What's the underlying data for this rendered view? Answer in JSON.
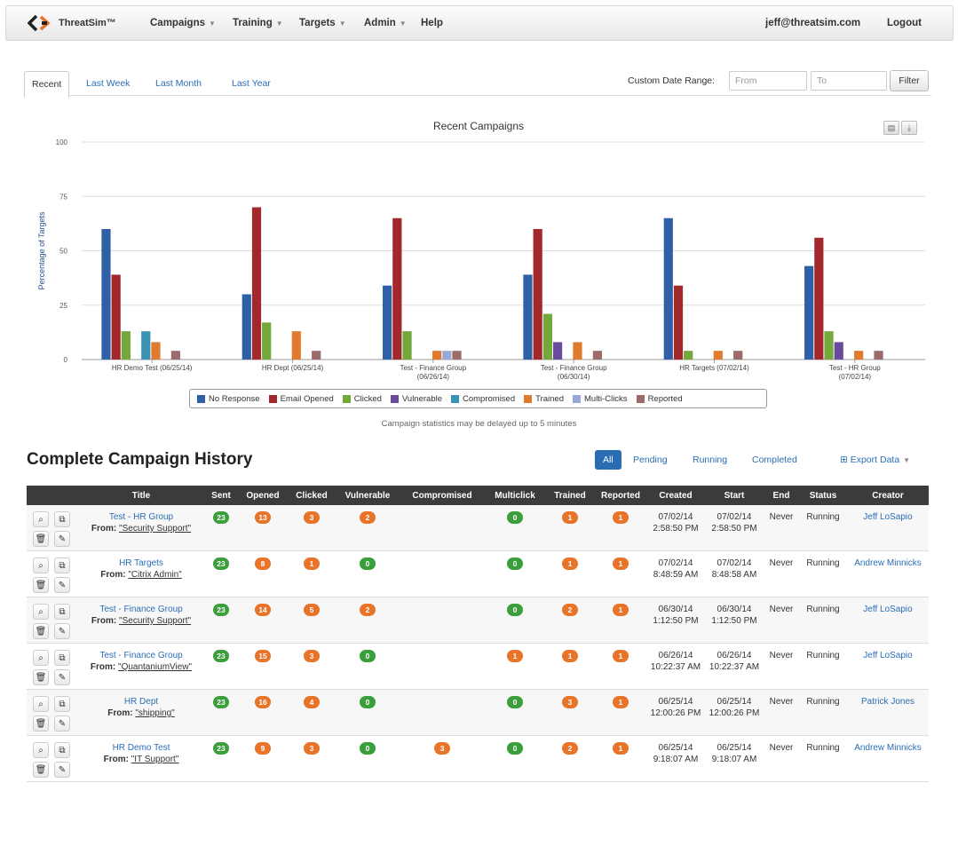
{
  "nav": {
    "brand": "ThreatSim™",
    "items": [
      "Campaigns",
      "Training",
      "Targets",
      "Admin",
      "Help"
    ],
    "user": "jeff@threatsim.com",
    "logout": "Logout"
  },
  "tabs": [
    "Recent",
    "Last Week",
    "Last Month",
    "Last Year"
  ],
  "date_range": {
    "label": "Custom Date Range:",
    "from_placeholder": "From",
    "to_placeholder": "To",
    "filter": "Filter"
  },
  "chart_data": {
    "type": "bar",
    "title": "Recent Campaigns",
    "ylabel": "Percentage of Targets",
    "ylim": [
      0,
      100
    ],
    "yticks": [
      0,
      25,
      50,
      75,
      100
    ],
    "grid": true,
    "legend_position": "bottom",
    "categories": [
      "HR Demo Test (06/25/14)",
      "HR Dept (06/25/14)",
      "Test - Finance Group (06/26/14)",
      "Test - Finance Group (06/30/14)",
      "HR Targets (07/02/14)",
      "Test - HR Group (07/02/14)"
    ],
    "series": [
      {
        "name": "No Response",
        "color": "#2f5fa7",
        "values": [
          60,
          30,
          34,
          39,
          65,
          43
        ]
      },
      {
        "name": "Email Opened",
        "color": "#a3282c",
        "values": [
          39,
          70,
          65,
          60,
          34,
          56
        ]
      },
      {
        "name": "Clicked",
        "color": "#73a83a",
        "values": [
          13,
          17,
          13,
          21,
          4,
          13
        ]
      },
      {
        "name": "Vulnerable",
        "color": "#6a4a9c",
        "values": [
          0,
          0,
          0,
          8,
          0,
          8
        ]
      },
      {
        "name": "Compromised",
        "color": "#3b93b3",
        "values": [
          13,
          0,
          0,
          0,
          0,
          0
        ]
      },
      {
        "name": "Trained",
        "color": "#e07b2e",
        "values": [
          8,
          13,
          4,
          8,
          4,
          4
        ]
      },
      {
        "name": "Multi-Clicks",
        "color": "#97a9d8",
        "values": [
          0,
          0,
          4,
          0,
          0,
          0
        ]
      },
      {
        "name": "Reported",
        "color": "#9b6a6a",
        "values": [
          4,
          4,
          4,
          4,
          4,
          4
        ]
      }
    ]
  },
  "delay_note": "Campaign statistics may be delayed up to 5 minutes",
  "history": {
    "title": "Complete Campaign History",
    "filters": [
      "All",
      "Pending",
      "Running",
      "Completed"
    ],
    "export": "Export Data",
    "from_label": "From:",
    "columns": [
      "",
      "Title",
      "Sent",
      "Opened",
      "Clicked",
      "Vulnerable",
      "Compromised",
      "Multiclick",
      "Trained",
      "Reported",
      "Created",
      "Start",
      "End",
      "Status",
      "Creator"
    ],
    "rows": [
      {
        "title": "Test - HR Group",
        "from": "\"Security Support\"",
        "sent": "23",
        "opened": "13",
        "clicked": "3",
        "vulnerable": "2",
        "compromised": "",
        "multiclick": "0",
        "trained": "1",
        "reported": "1",
        "created": "07/02/14 2:58:50 PM",
        "start": "07/02/14 2:58:50 PM",
        "end": "Never",
        "status": "Running",
        "creator": "Jeff LoSapio"
      },
      {
        "title": "HR Targets",
        "from": "\"Citrix Admin\"",
        "sent": "23",
        "opened": "8",
        "clicked": "1",
        "vulnerable": "0",
        "compromised": "",
        "multiclick": "0",
        "trained": "1",
        "reported": "1",
        "created": "07/02/14 8:48:59 AM",
        "start": "07/02/14 8:48:58 AM",
        "end": "Never",
        "status": "Running",
        "creator": "Andrew Minnicks"
      },
      {
        "title": "Test - Finance Group",
        "from": "\"Security Support\"",
        "sent": "23",
        "opened": "14",
        "clicked": "5",
        "vulnerable": "2",
        "compromised": "",
        "multiclick": "0",
        "trained": "2",
        "reported": "1",
        "created": "06/30/14 1:12:50 PM",
        "start": "06/30/14 1:12:50 PM",
        "end": "Never",
        "status": "Running",
        "creator": "Jeff LoSapio"
      },
      {
        "title": "Test - Finance Group",
        "from": "\"QuantaniumView\"",
        "sent": "23",
        "opened": "15",
        "clicked": "3",
        "vulnerable": "0",
        "compromised": "",
        "multiclick": "1",
        "trained": "1",
        "reported": "1",
        "created": "06/26/14 10:22:37 AM",
        "start": "06/26/14 10:22:37 AM",
        "end": "Never",
        "status": "Running",
        "creator": "Jeff LoSapio"
      },
      {
        "title": "HR Dept",
        "from": "\"shipping\"",
        "sent": "23",
        "opened": "16",
        "clicked": "4",
        "vulnerable": "0",
        "compromised": "",
        "multiclick": "0",
        "trained": "3",
        "reported": "1",
        "created": "06/25/14 12:00:26 PM",
        "start": "06/25/14 12:00:26 PM",
        "end": "Never",
        "status": "Running",
        "creator": "Patrick Jones"
      },
      {
        "title": "HR Demo Test",
        "from": "\"IT Support\"",
        "sent": "23",
        "opened": "9",
        "clicked": "3",
        "vulnerable": "0",
        "compromised": "3",
        "multiclick": "0",
        "trained": "2",
        "reported": "1",
        "created": "06/25/14 9:18:07 AM",
        "start": "06/25/14 9:18:07 AM",
        "end": "Never",
        "status": "Running",
        "creator": "Andrew Minnicks"
      }
    ]
  }
}
